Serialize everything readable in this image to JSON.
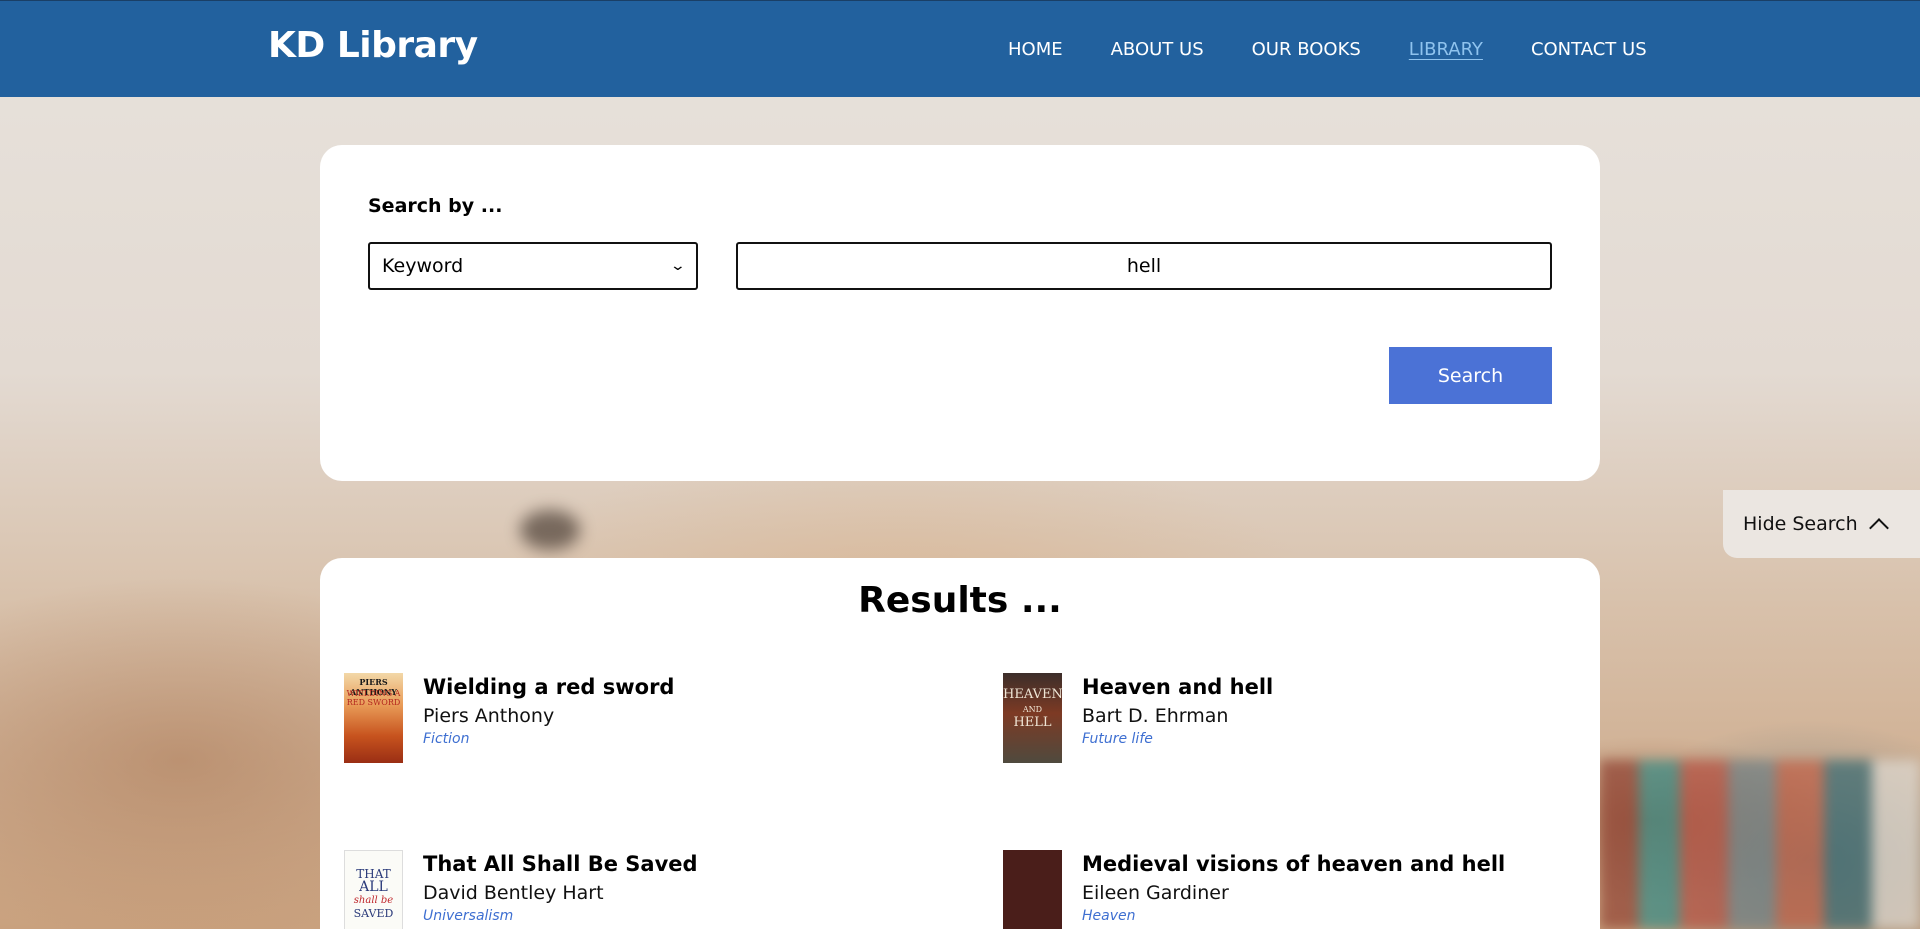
{
  "header": {
    "brand": "KD Library",
    "nav": [
      {
        "label": "HOME"
      },
      {
        "label": "ABOUT US"
      },
      {
        "label": "OUR BOOKS"
      },
      {
        "label": "LIBRARY",
        "active": true
      },
      {
        "label": "CONTACT US"
      }
    ]
  },
  "search": {
    "label": "Search by ...",
    "mode": "Keyword",
    "query": "hell",
    "button": "Search"
  },
  "toggle": {
    "label": "Hide Search",
    "icon": "chevron-up-icon"
  },
  "results": {
    "title": "Results ...",
    "books": [
      {
        "title": "Wielding a red sword",
        "author": "Piers Anthony",
        "genre": "Fiction",
        "cover_text": [
          "PIERS ANTHONY",
          "WIELDING A RED SWORD"
        ]
      },
      {
        "title": "Heaven and hell",
        "author": "Bart D. Ehrman",
        "genre": "Future life",
        "cover_text": [
          "HEAVEN",
          "AND",
          "HELL"
        ]
      },
      {
        "title": "That All Shall Be Saved",
        "author": "David Bentley Hart",
        "genre": "Universalism",
        "cover_text": [
          "THAT",
          "ALL",
          "shall be",
          "SAVED"
        ]
      },
      {
        "title": "Medieval visions of heaven and hell",
        "author": "Eileen Gardiner",
        "genre": "Heaven",
        "cover_text": []
      }
    ]
  },
  "colors": {
    "navbar": "#22619e",
    "accent": "#4b72d6",
    "active_link": "#8fc3ee",
    "genre": "#3e6fd1"
  }
}
